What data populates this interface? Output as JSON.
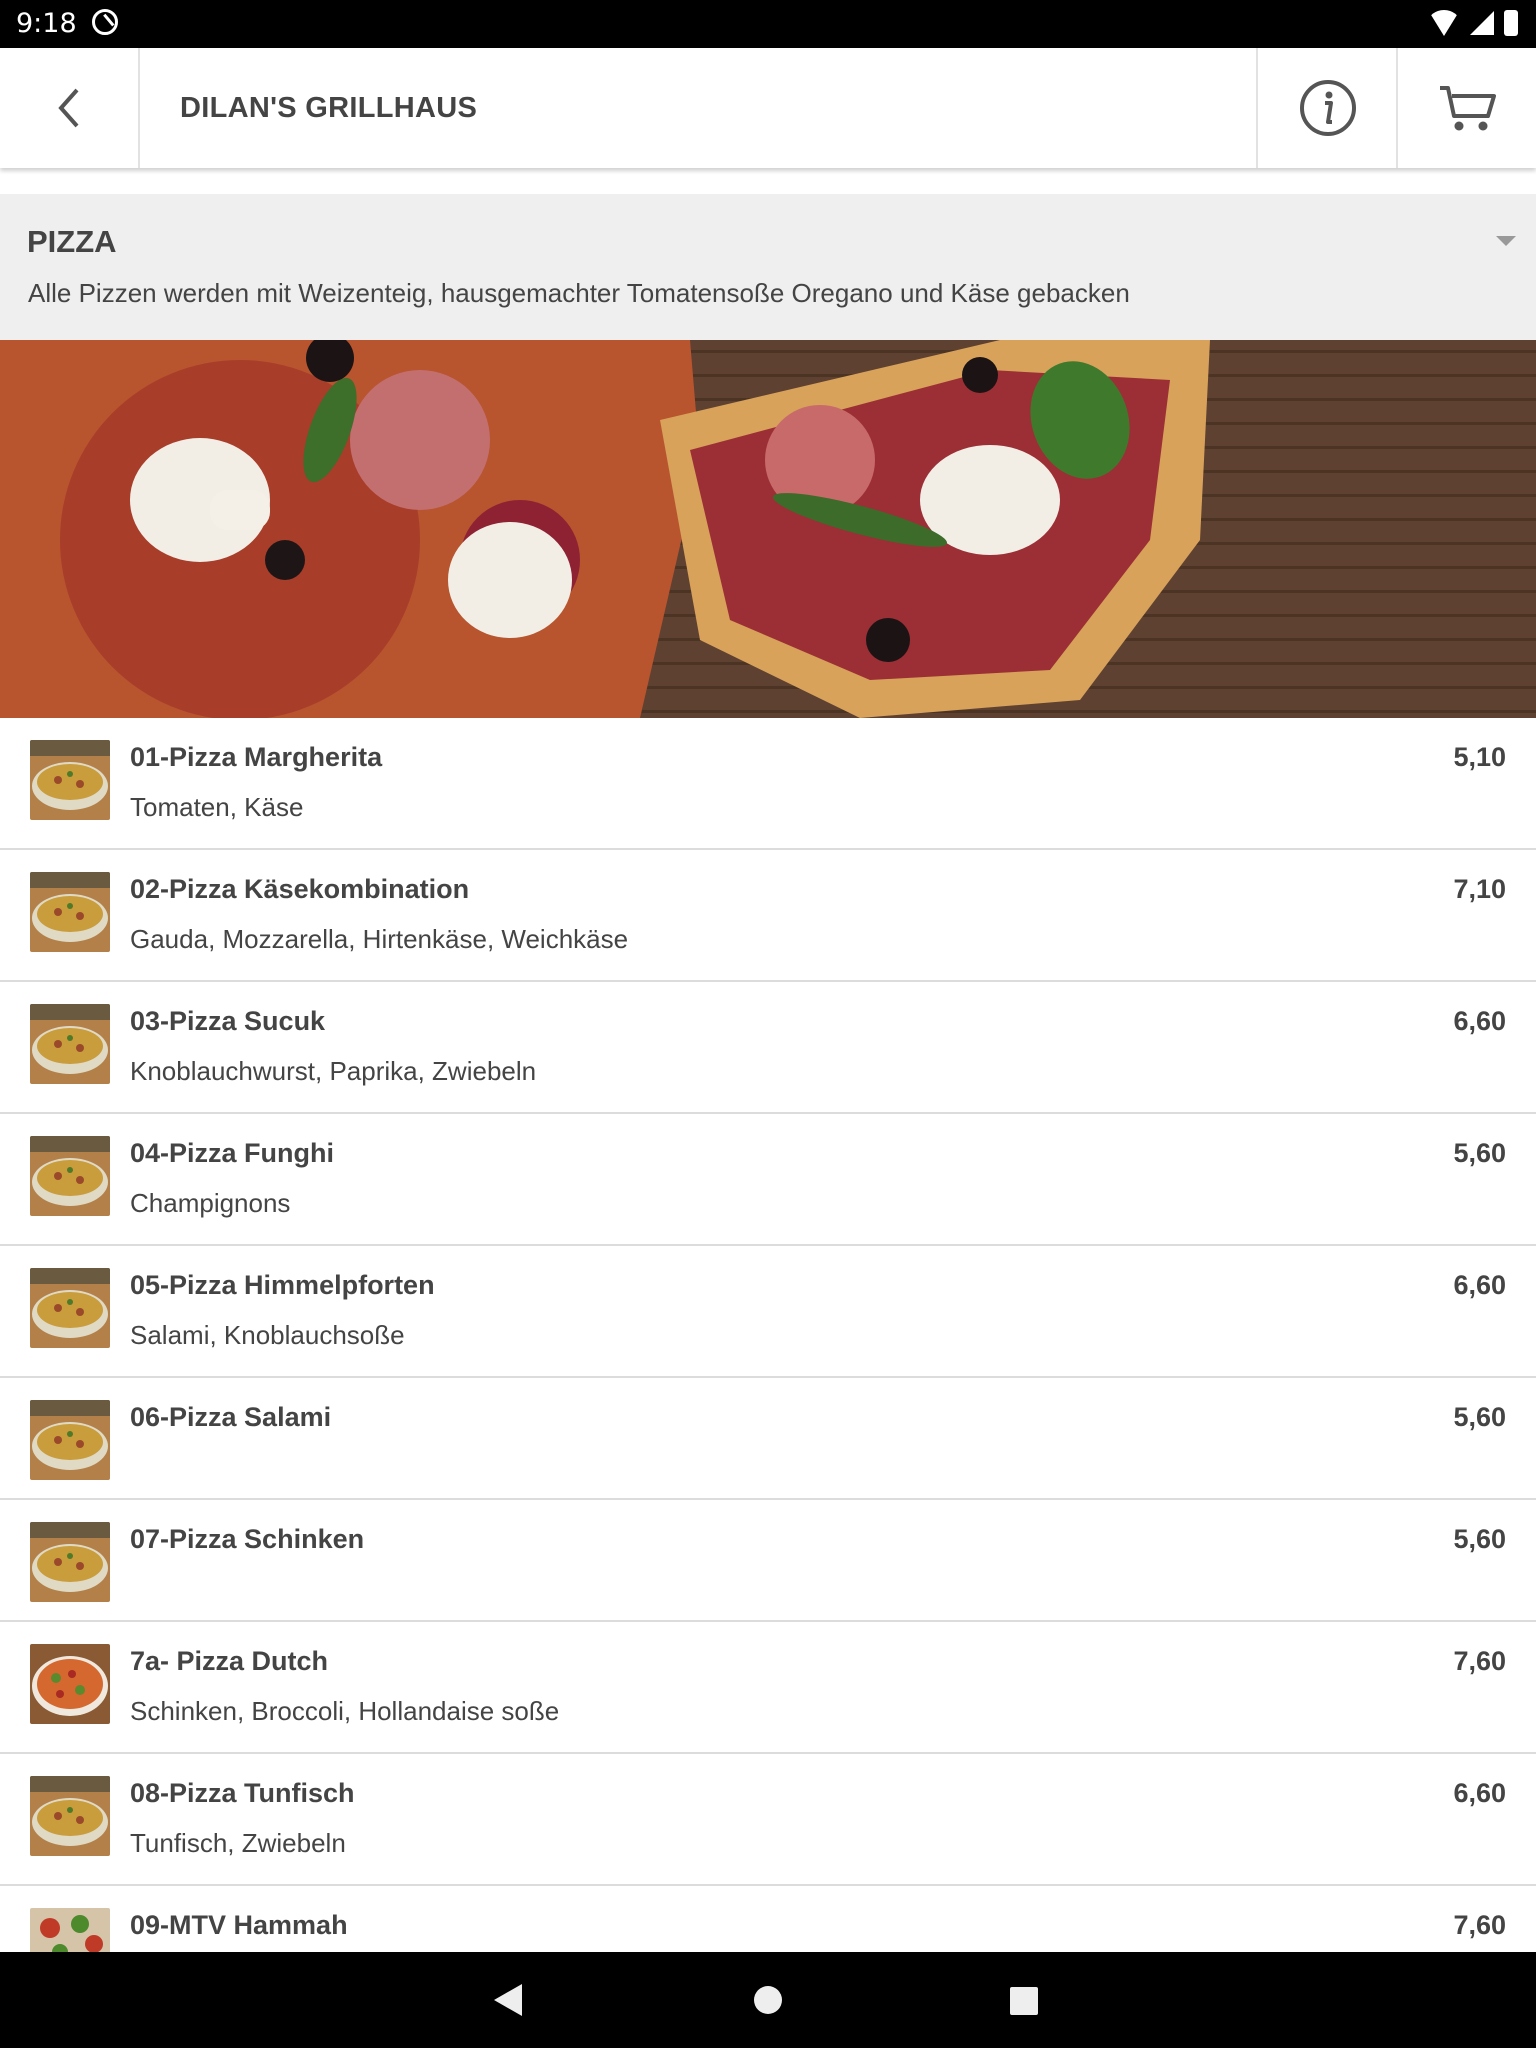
{
  "status_bar": {
    "time": "9:18"
  },
  "header": {
    "title": "DILAN'S GRILLHAUS"
  },
  "category": {
    "title": "PIZZA",
    "description": "Alle Pizzen werden mit Weizenteig, hausgemachter Tomatensoße Oregano und Käse gebacken"
  },
  "items": [
    {
      "name": "01-Pizza Margherita",
      "desc": "Tomaten, Käse",
      "price": "5,10"
    },
    {
      "name": "02-Pizza Käsekombination",
      "desc": "Gauda, Mozzarella, Hirtenkäse, Weichkäse",
      "price": "7,10"
    },
    {
      "name": "03-Pizza Sucuk",
      "desc": "Knoblauchwurst, Paprika, Zwiebeln",
      "price": "6,60"
    },
    {
      "name": "04-Pizza Funghi",
      "desc": "Champignons",
      "price": "5,60"
    },
    {
      "name": "05-Pizza Himmelpforten",
      "desc": "Salami, Knoblauchsoße",
      "price": "6,60"
    },
    {
      "name": "06-Pizza Salami",
      "desc": "",
      "price": "5,60"
    },
    {
      "name": "07-Pizza Schinken",
      "desc": "",
      "price": "5,60"
    },
    {
      "name": "7a- Pizza Dutch",
      "desc": "Schinken, Broccoli, Hollandaise soße",
      "price": "7,60"
    },
    {
      "name": "08-Pizza Tunfisch",
      "desc": "Tunfisch, Zwiebeln",
      "price": "6,60"
    },
    {
      "name": "09-MTV Hammah",
      "desc": "",
      "price": "7,60"
    }
  ]
}
